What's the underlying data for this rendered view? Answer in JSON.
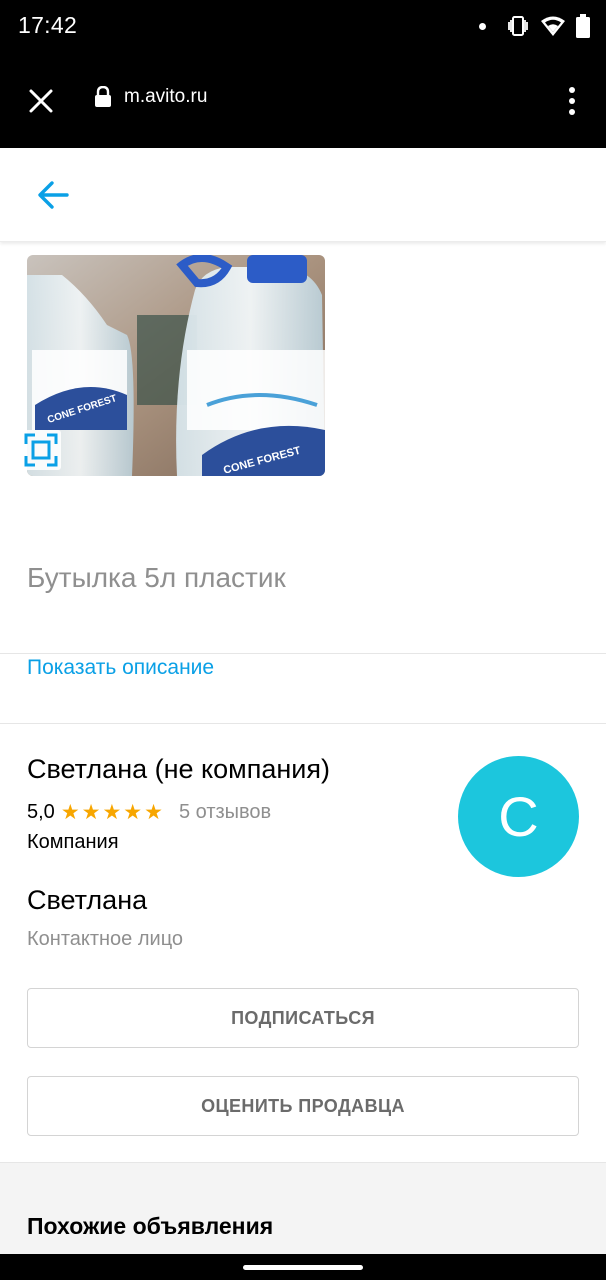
{
  "status_bar": {
    "time": "17:42"
  },
  "browser": {
    "url": "m.avito.ru"
  },
  "item": {
    "title": "Бутылка 5л пластик",
    "show_description": "Показать описание"
  },
  "seller": {
    "name": "Светлана (не компания)",
    "rating": "5,0",
    "stars": 5,
    "reviews": "5 отзывов",
    "type": "Компания",
    "avatar_letter": "С",
    "avatar_color": "#1cc6dd"
  },
  "contact": {
    "name": "Светлана",
    "role": "Контактное лицо"
  },
  "actions": {
    "subscribe": "ПОДПИСАТЬСЯ",
    "rate_seller": "ОЦЕНИТЬ ПРОДАВЦА"
  },
  "similar": {
    "title": "Похожие объявления"
  },
  "colors": {
    "accent": "#0aa0e6",
    "star": "#f7a600"
  }
}
